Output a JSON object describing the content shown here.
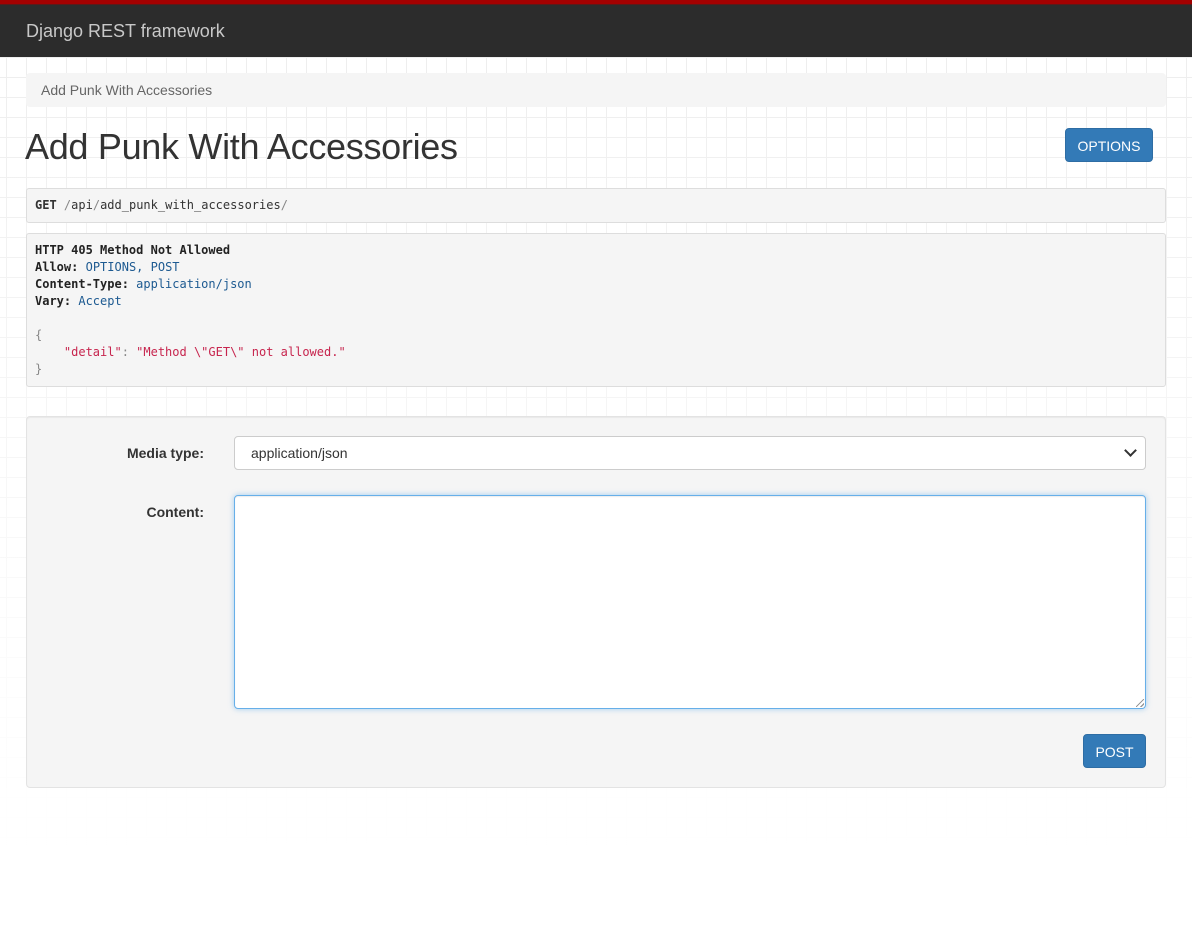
{
  "navbar": {
    "brand": "Django REST framework",
    "accent_color": "#a30000",
    "background_color": "#2c2c2c"
  },
  "breadcrumb": {
    "items": [
      "Add Punk With Accessories"
    ]
  },
  "page": {
    "title": "Add Punk With Accessories",
    "options_label": "OPTIONS"
  },
  "request": {
    "method": "GET",
    "path_prefix": "/",
    "path_segment_1": "api",
    "path_sep": "/",
    "path_segment_2": "add_punk_with_accessories",
    "path_suffix": "/"
  },
  "response": {
    "status_line": "HTTP 405 Method Not Allowed",
    "headers": [
      {
        "key": "Allow:",
        "value": "OPTIONS, POST"
      },
      {
        "key": "Content-Type:",
        "value": "application/json"
      },
      {
        "key": "Vary:",
        "value": "Accept"
      }
    ],
    "body": {
      "open_brace": "{",
      "key": "\"detail\"",
      "colon": ": ",
      "value": "\"Method \\\"GET\\\" not allowed.\"",
      "close_brace": "}"
    }
  },
  "form": {
    "media_type_label": "Media type:",
    "media_type_value": "application/json",
    "content_label": "Content:",
    "content_value": "",
    "post_label": "POST",
    "primary_color": "#337ab7"
  }
}
